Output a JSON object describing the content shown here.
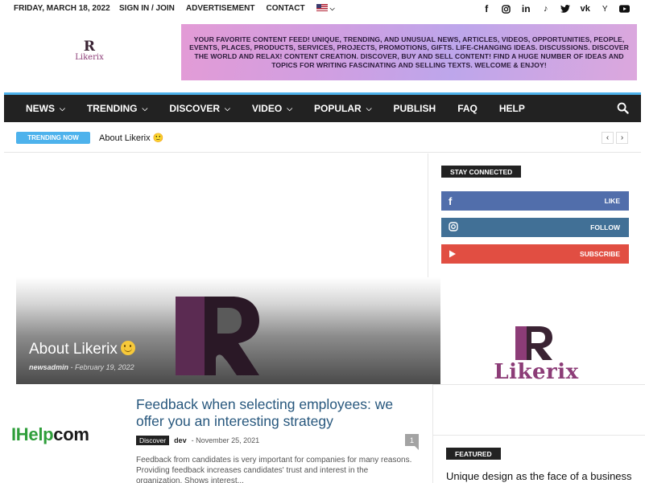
{
  "topbar": {
    "date": "FRIDAY, MARCH 18, 2022",
    "links": [
      "SIGN IN / JOIN",
      "ADVERTISEMENT",
      "CONTACT"
    ],
    "language": "EN",
    "socials": [
      "facebook-icon",
      "instagram-icon",
      "linkedin-icon",
      "tiktok-icon",
      "twitter-icon",
      "vk-icon",
      "yandex-icon",
      "youtube-icon"
    ]
  },
  "header": {
    "logo_mark": "R",
    "logo_text": "Likerix",
    "banner_text": "YOUR FAVORITE CONTENT FEED! UNIQUE, TRENDING, AND UNUSUAL NEWS, ARTICLES, VIDEOS, OPPORTUNITIES, PEOPLE, EVENTS, PLACES, PRODUCTS, SERVICES, PROJECTS, PROMOTIONS, GIFTS. LIFE-CHANGING IDEAS. DISCUSSIONS. DISCOVER THE WORLD AND RELAX! CONTENT CREATION. DISCOVER, BUY AND SELL CONTENT! FIND A HUGE NUMBER OF IDEAS AND TOPICS FOR WRITING FASCINATING AND SELLING TEXTS. WELCOME & ENJOY!"
  },
  "nav": {
    "items": [
      {
        "label": "NEWS",
        "dropdown": true
      },
      {
        "label": "TRENDING",
        "dropdown": true
      },
      {
        "label": "DISCOVER",
        "dropdown": true
      },
      {
        "label": "VIDEO",
        "dropdown": true
      },
      {
        "label": "POPULAR",
        "dropdown": true
      },
      {
        "label": "PUBLISH",
        "dropdown": false
      },
      {
        "label": "FAQ",
        "dropdown": false
      },
      {
        "label": "HELP",
        "dropdown": false
      }
    ]
  },
  "trending": {
    "badge": "TRENDING NOW",
    "title": "About Likerix 🙂",
    "prev": "‹",
    "next": "›"
  },
  "feature": {
    "title": "About Likerix",
    "author": "newsadmin",
    "date": "- February 19, 2022"
  },
  "sidebar": {
    "stay_connected": "STAY CONNECTED",
    "facebook": {
      "icon": "f",
      "label": "LIKE",
      "color": "#516eab"
    },
    "instagram": {
      "label": "FOLLOW",
      "color": "#417096"
    },
    "youtube": {
      "label": "SUBSCRIBE",
      "color": "#e14e42"
    },
    "logo_text": "Likerix",
    "featured": "FEATURED",
    "featured_title": "Unique design as the face of a business"
  },
  "article": {
    "thumb_brand_a": "IHelp",
    "thumb_brand_b": "com",
    "title": "Feedback when selecting employees: we offer you an interesting strategy",
    "category": "Discover",
    "author": "dev",
    "date": "- November 25, 2021",
    "comments": "1",
    "excerpt": "Feedback from candidates is very important for companies for many reasons. Providing feedback increases candidates' trust and interest in the organization. Shows interest..."
  },
  "colors": {
    "accent": "#4db2ec",
    "nav_bg": "#222222",
    "brand_purple": "#8c3c77",
    "link_blue": "#27577d"
  }
}
